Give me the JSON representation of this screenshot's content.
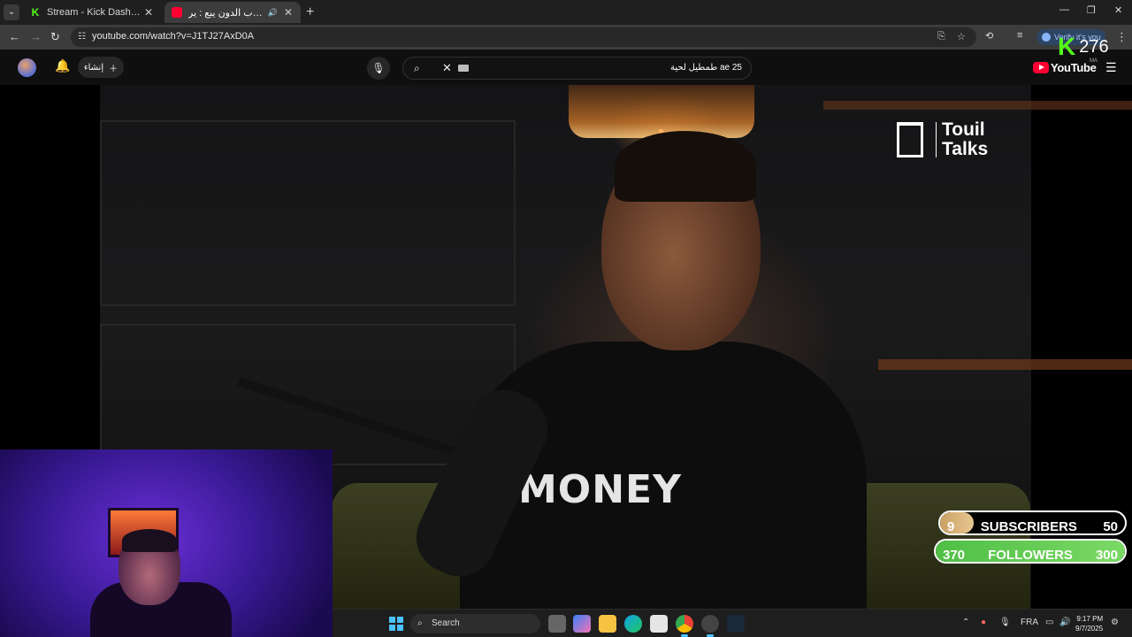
{
  "browser": {
    "tabs": [
      {
        "title": "Stream - Kick Dashboard",
        "favicon": "kick-icon",
        "active": false
      },
      {
        "title": "مع توفيق حازب الدون يبع : ير",
        "favicon": "youtube-icon",
        "active": true,
        "audio": true
      }
    ],
    "new_tab": "+",
    "url": "youtube.com/watch?v=J1TJ27AxD0A",
    "profile_chip": "Verify it's you"
  },
  "youtube": {
    "create_label": "إنشاء",
    "search_query": "ae 25 طمطيل لحية",
    "logo_text": "YouTube",
    "region": "MA"
  },
  "kick_counter": {
    "value": "276",
    "accent": "#53fc18"
  },
  "video": {
    "watermark_line1": "Touil",
    "watermark_line2": "Talks",
    "shirt_text": "MONEY"
  },
  "goals": {
    "subscribers": {
      "label": "SUBSCRIBERS",
      "current": 9,
      "target": 50,
      "fill_percent": 18,
      "color": "#c9a063"
    },
    "followers": {
      "label": "FOLLOWERS",
      "current": 370,
      "target": 300,
      "fill_percent": 100,
      "color": "#4fbf45"
    }
  },
  "taskbar": {
    "search_label": "Search",
    "language": "FRA",
    "time": "9:17 PM",
    "date": "9/7/2025"
  }
}
